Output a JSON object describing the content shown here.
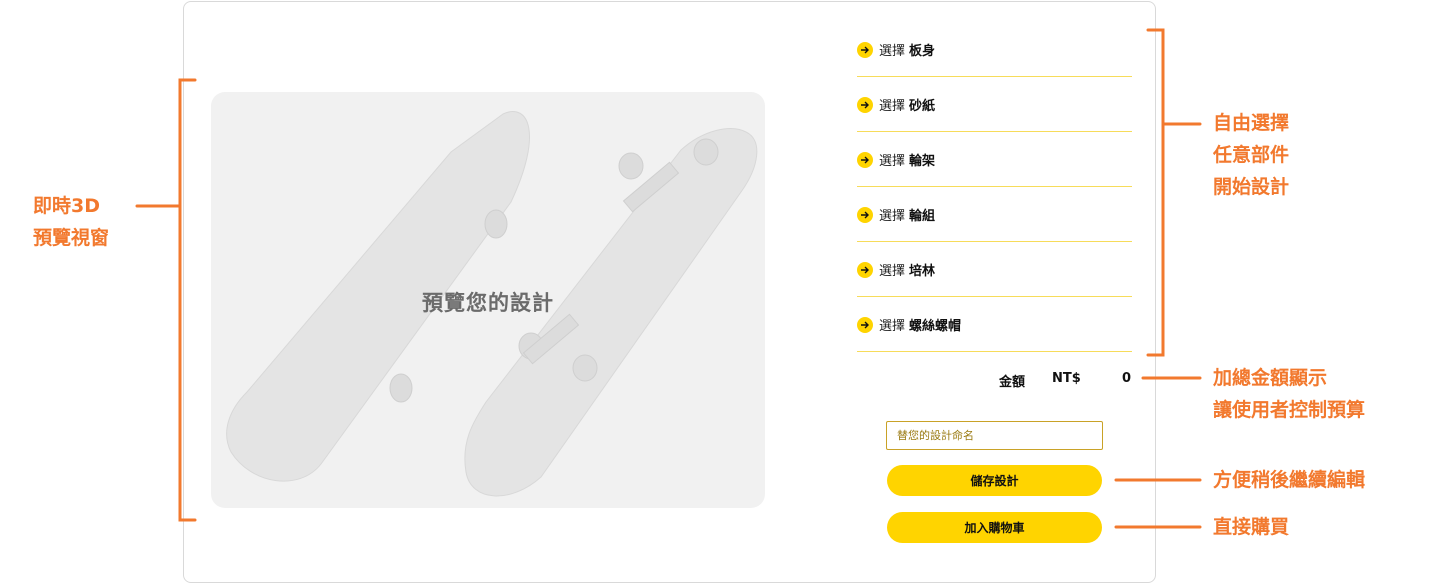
{
  "preview": {
    "label": "預覽您的設計"
  },
  "parts": {
    "prefix": "選擇",
    "items": [
      {
        "name": "板身"
      },
      {
        "name": "砂紙"
      },
      {
        "name": "輪架"
      },
      {
        "name": "輪組"
      },
      {
        "name": "培林"
      },
      {
        "name": "螺絲螺帽"
      }
    ]
  },
  "total": {
    "label": "金額",
    "currency": "NT$",
    "amount": "0"
  },
  "design_name": {
    "placeholder": "替您的設計命名"
  },
  "buttons": {
    "save": "儲存設計",
    "cart": "加入購物車"
  },
  "annotations": {
    "preview": [
      "即時3D",
      "預覽視窗"
    ],
    "parts": [
      "自由選擇",
      "任意部件",
      "開始設計"
    ],
    "total": [
      "加總金額顯示",
      "讓使用者控制預算"
    ],
    "save": "方便稍後繼續編輯",
    "cart": "直接購買"
  },
  "colors": {
    "accent": "#ffd400",
    "annotation": "#f2792e",
    "divider": "#f7dc5a"
  }
}
